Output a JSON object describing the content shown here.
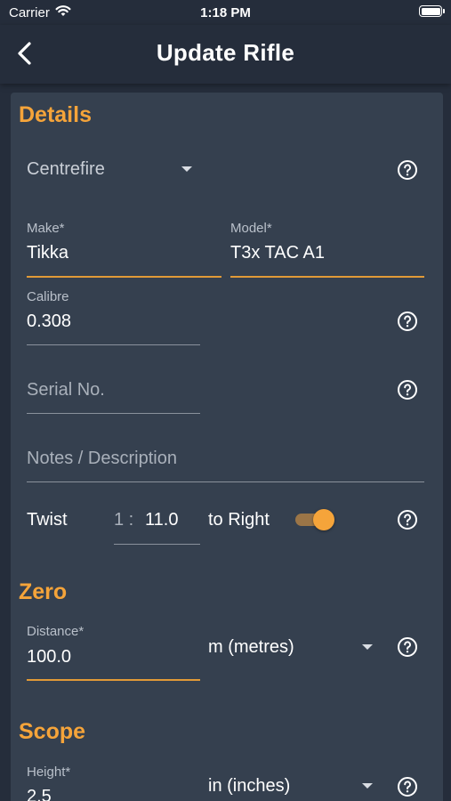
{
  "status_bar": {
    "carrier": "Carrier",
    "time": "1:18 PM"
  },
  "app_bar": {
    "title": "Update Rifle"
  },
  "details": {
    "heading": "Details",
    "type": {
      "selected": "Centrefire"
    },
    "make": {
      "label": "Make*",
      "value": "Tikka"
    },
    "model": {
      "label": "Model*",
      "value": "T3x TAC A1"
    },
    "calibre": {
      "label": "Calibre",
      "value": "0.308"
    },
    "serial": {
      "placeholder": "Serial No."
    },
    "notes": {
      "placeholder": "Notes / Description"
    },
    "twist": {
      "label": "Twist",
      "prefix": "1 :",
      "value": "11.0",
      "direction": "to Right",
      "enabled": true
    }
  },
  "zero": {
    "heading": "Zero",
    "distance": {
      "label": "Distance*",
      "value": "100.0",
      "unit": "m (metres)"
    }
  },
  "scope": {
    "heading": "Scope",
    "height": {
      "label": "Height*",
      "value": "2.5",
      "unit": "in (inches)"
    }
  },
  "colors": {
    "accent": "#f5a43a",
    "background": "#252d3b",
    "card": "#35404f"
  }
}
